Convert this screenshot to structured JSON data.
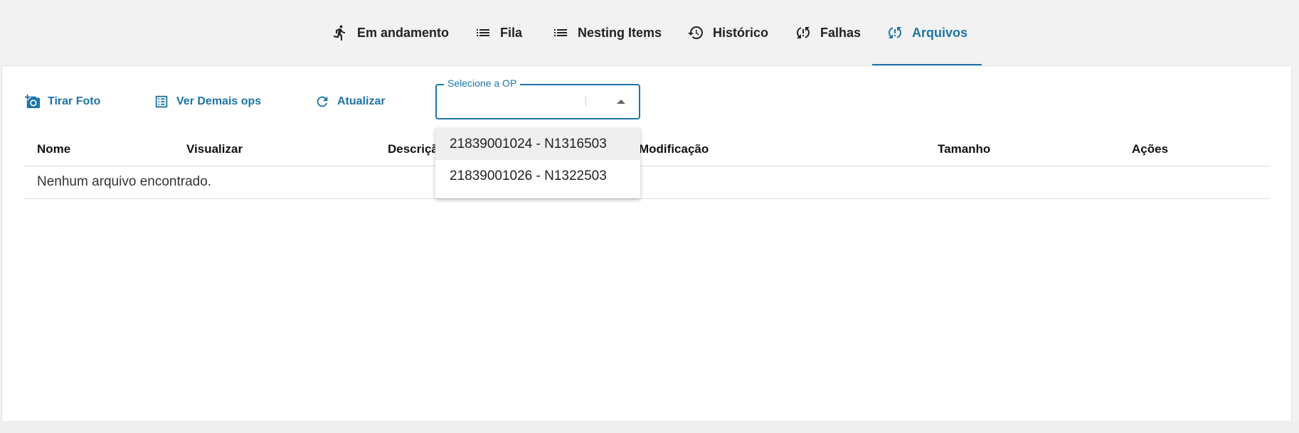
{
  "tabs": [
    {
      "label": "Em andamento",
      "icon": "running-person-icon",
      "active": false
    },
    {
      "label": "Fila",
      "icon": "list-icon",
      "active": false
    },
    {
      "label": "Nesting Items",
      "icon": "list-icon",
      "active": false
    },
    {
      "label": "Histórico",
      "icon": "history-icon",
      "active": false
    },
    {
      "label": "Falhas",
      "icon": "sync-problem-icon",
      "active": false
    },
    {
      "label": "Arquivos",
      "icon": "sync-problem-icon",
      "active": true
    }
  ],
  "toolbar": {
    "tirar_foto": "Tirar Foto",
    "ver_demais_ops": "Ver Demais ops",
    "atualizar": "Atualizar"
  },
  "select": {
    "label": "Selecione a OP",
    "value": "",
    "options": [
      "21839001024 - N1316503",
      "21839001026 - N1322503"
    ]
  },
  "table": {
    "columns": [
      "Nome",
      "Visualizar",
      "Descrição",
      "Modificação",
      "Tamanho",
      "Ações"
    ],
    "visible_partial_column": "Descriçã",
    "empty_message": "Nenhum arquivo encontrado."
  },
  "colors": {
    "accent": "#1d74a8",
    "background": "#f2f2f2",
    "panel": "#ffffff"
  }
}
